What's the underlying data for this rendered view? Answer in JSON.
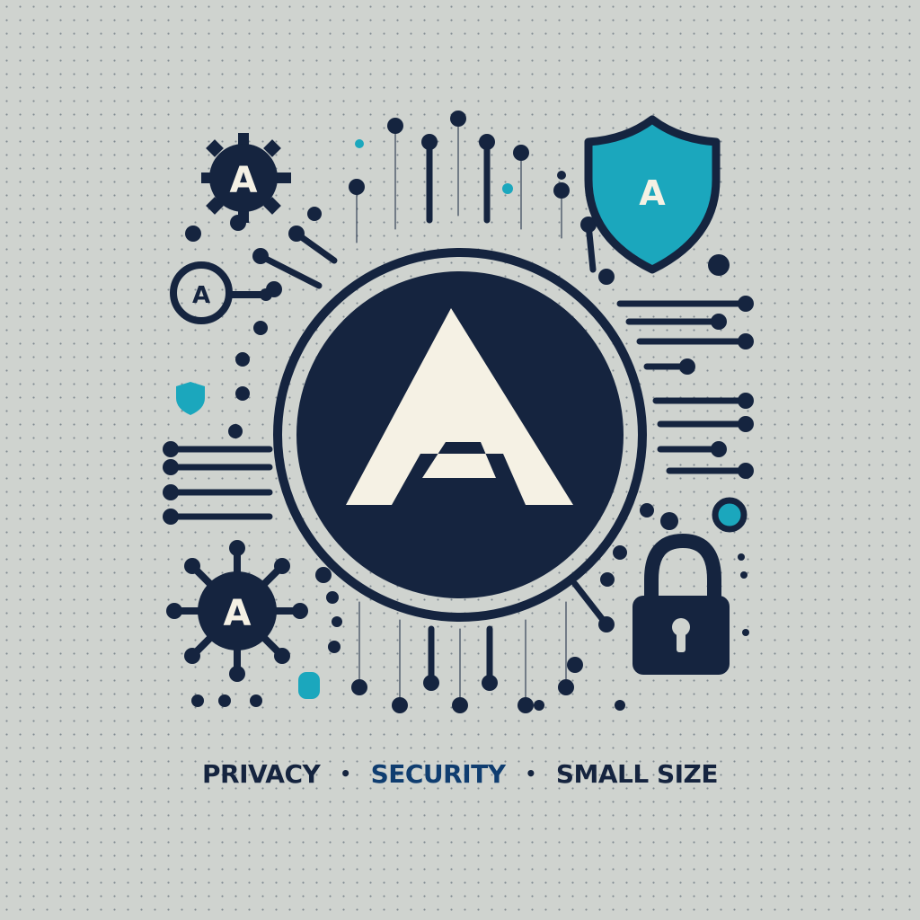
{
  "logo": {
    "letter": "A"
  },
  "badges": [
    {
      "name": "gear-badge-top-left",
      "letter": "A"
    },
    {
      "name": "shield-badge",
      "letter": "A"
    },
    {
      "name": "circle-badge-left",
      "letter": "A"
    },
    {
      "name": "virus-badge-bottom-left",
      "letter": "A"
    }
  ],
  "tagline": {
    "items": [
      "PRIVACY",
      "SECURITY",
      "SMALL SIZE"
    ],
    "separator": "•"
  },
  "colors": {
    "background": "#cfd3cf",
    "navy": "#15243f",
    "teal": "#1ba7bd",
    "cream": "#f5f1e4"
  },
  "icons": [
    "gear-icon",
    "shield-icon",
    "lock-icon",
    "virus-icon",
    "circuit-lines"
  ]
}
